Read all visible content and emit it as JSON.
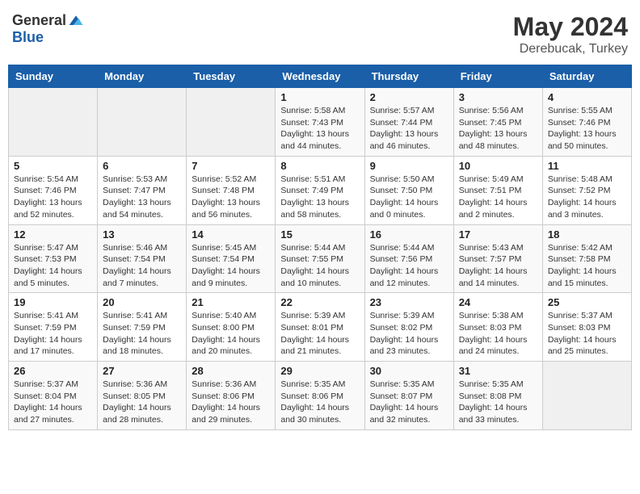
{
  "header": {
    "logo_general": "General",
    "logo_blue": "Blue",
    "month": "May 2024",
    "location": "Derebucak, Turkey"
  },
  "weekdays": [
    "Sunday",
    "Monday",
    "Tuesday",
    "Wednesday",
    "Thursday",
    "Friday",
    "Saturday"
  ],
  "weeks": [
    [
      {
        "day": "",
        "sunrise": "",
        "sunset": "",
        "daylight": ""
      },
      {
        "day": "",
        "sunrise": "",
        "sunset": "",
        "daylight": ""
      },
      {
        "day": "",
        "sunrise": "",
        "sunset": "",
        "daylight": ""
      },
      {
        "day": "1",
        "sunrise": "Sunrise: 5:58 AM",
        "sunset": "Sunset: 7:43 PM",
        "daylight": "Daylight: 13 hours and 44 minutes."
      },
      {
        "day": "2",
        "sunrise": "Sunrise: 5:57 AM",
        "sunset": "Sunset: 7:44 PM",
        "daylight": "Daylight: 13 hours and 46 minutes."
      },
      {
        "day": "3",
        "sunrise": "Sunrise: 5:56 AM",
        "sunset": "Sunset: 7:45 PM",
        "daylight": "Daylight: 13 hours and 48 minutes."
      },
      {
        "day": "4",
        "sunrise": "Sunrise: 5:55 AM",
        "sunset": "Sunset: 7:46 PM",
        "daylight": "Daylight: 13 hours and 50 minutes."
      }
    ],
    [
      {
        "day": "5",
        "sunrise": "Sunrise: 5:54 AM",
        "sunset": "Sunset: 7:46 PM",
        "daylight": "Daylight: 13 hours and 52 minutes."
      },
      {
        "day": "6",
        "sunrise": "Sunrise: 5:53 AM",
        "sunset": "Sunset: 7:47 PM",
        "daylight": "Daylight: 13 hours and 54 minutes."
      },
      {
        "day": "7",
        "sunrise": "Sunrise: 5:52 AM",
        "sunset": "Sunset: 7:48 PM",
        "daylight": "Daylight: 13 hours and 56 minutes."
      },
      {
        "day": "8",
        "sunrise": "Sunrise: 5:51 AM",
        "sunset": "Sunset: 7:49 PM",
        "daylight": "Daylight: 13 hours and 58 minutes."
      },
      {
        "day": "9",
        "sunrise": "Sunrise: 5:50 AM",
        "sunset": "Sunset: 7:50 PM",
        "daylight": "Daylight: 14 hours and 0 minutes."
      },
      {
        "day": "10",
        "sunrise": "Sunrise: 5:49 AM",
        "sunset": "Sunset: 7:51 PM",
        "daylight": "Daylight: 14 hours and 2 minutes."
      },
      {
        "day": "11",
        "sunrise": "Sunrise: 5:48 AM",
        "sunset": "Sunset: 7:52 PM",
        "daylight": "Daylight: 14 hours and 3 minutes."
      }
    ],
    [
      {
        "day": "12",
        "sunrise": "Sunrise: 5:47 AM",
        "sunset": "Sunset: 7:53 PM",
        "daylight": "Daylight: 14 hours and 5 minutes."
      },
      {
        "day": "13",
        "sunrise": "Sunrise: 5:46 AM",
        "sunset": "Sunset: 7:54 PM",
        "daylight": "Daylight: 14 hours and 7 minutes."
      },
      {
        "day": "14",
        "sunrise": "Sunrise: 5:45 AM",
        "sunset": "Sunset: 7:54 PM",
        "daylight": "Daylight: 14 hours and 9 minutes."
      },
      {
        "day": "15",
        "sunrise": "Sunrise: 5:44 AM",
        "sunset": "Sunset: 7:55 PM",
        "daylight": "Daylight: 14 hours and 10 minutes."
      },
      {
        "day": "16",
        "sunrise": "Sunrise: 5:44 AM",
        "sunset": "Sunset: 7:56 PM",
        "daylight": "Daylight: 14 hours and 12 minutes."
      },
      {
        "day": "17",
        "sunrise": "Sunrise: 5:43 AM",
        "sunset": "Sunset: 7:57 PM",
        "daylight": "Daylight: 14 hours and 14 minutes."
      },
      {
        "day": "18",
        "sunrise": "Sunrise: 5:42 AM",
        "sunset": "Sunset: 7:58 PM",
        "daylight": "Daylight: 14 hours and 15 minutes."
      }
    ],
    [
      {
        "day": "19",
        "sunrise": "Sunrise: 5:41 AM",
        "sunset": "Sunset: 7:59 PM",
        "daylight": "Daylight: 14 hours and 17 minutes."
      },
      {
        "day": "20",
        "sunrise": "Sunrise: 5:41 AM",
        "sunset": "Sunset: 7:59 PM",
        "daylight": "Daylight: 14 hours and 18 minutes."
      },
      {
        "day": "21",
        "sunrise": "Sunrise: 5:40 AM",
        "sunset": "Sunset: 8:00 PM",
        "daylight": "Daylight: 14 hours and 20 minutes."
      },
      {
        "day": "22",
        "sunrise": "Sunrise: 5:39 AM",
        "sunset": "Sunset: 8:01 PM",
        "daylight": "Daylight: 14 hours and 21 minutes."
      },
      {
        "day": "23",
        "sunrise": "Sunrise: 5:39 AM",
        "sunset": "Sunset: 8:02 PM",
        "daylight": "Daylight: 14 hours and 23 minutes."
      },
      {
        "day": "24",
        "sunrise": "Sunrise: 5:38 AM",
        "sunset": "Sunset: 8:03 PM",
        "daylight": "Daylight: 14 hours and 24 minutes."
      },
      {
        "day": "25",
        "sunrise": "Sunrise: 5:37 AM",
        "sunset": "Sunset: 8:03 PM",
        "daylight": "Daylight: 14 hours and 25 minutes."
      }
    ],
    [
      {
        "day": "26",
        "sunrise": "Sunrise: 5:37 AM",
        "sunset": "Sunset: 8:04 PM",
        "daylight": "Daylight: 14 hours and 27 minutes."
      },
      {
        "day": "27",
        "sunrise": "Sunrise: 5:36 AM",
        "sunset": "Sunset: 8:05 PM",
        "daylight": "Daylight: 14 hours and 28 minutes."
      },
      {
        "day": "28",
        "sunrise": "Sunrise: 5:36 AM",
        "sunset": "Sunset: 8:06 PM",
        "daylight": "Daylight: 14 hours and 29 minutes."
      },
      {
        "day": "29",
        "sunrise": "Sunrise: 5:35 AM",
        "sunset": "Sunset: 8:06 PM",
        "daylight": "Daylight: 14 hours and 30 minutes."
      },
      {
        "day": "30",
        "sunrise": "Sunrise: 5:35 AM",
        "sunset": "Sunset: 8:07 PM",
        "daylight": "Daylight: 14 hours and 32 minutes."
      },
      {
        "day": "31",
        "sunrise": "Sunrise: 5:35 AM",
        "sunset": "Sunset: 8:08 PM",
        "daylight": "Daylight: 14 hours and 33 minutes."
      },
      {
        "day": "",
        "sunrise": "",
        "sunset": "",
        "daylight": ""
      }
    ]
  ]
}
